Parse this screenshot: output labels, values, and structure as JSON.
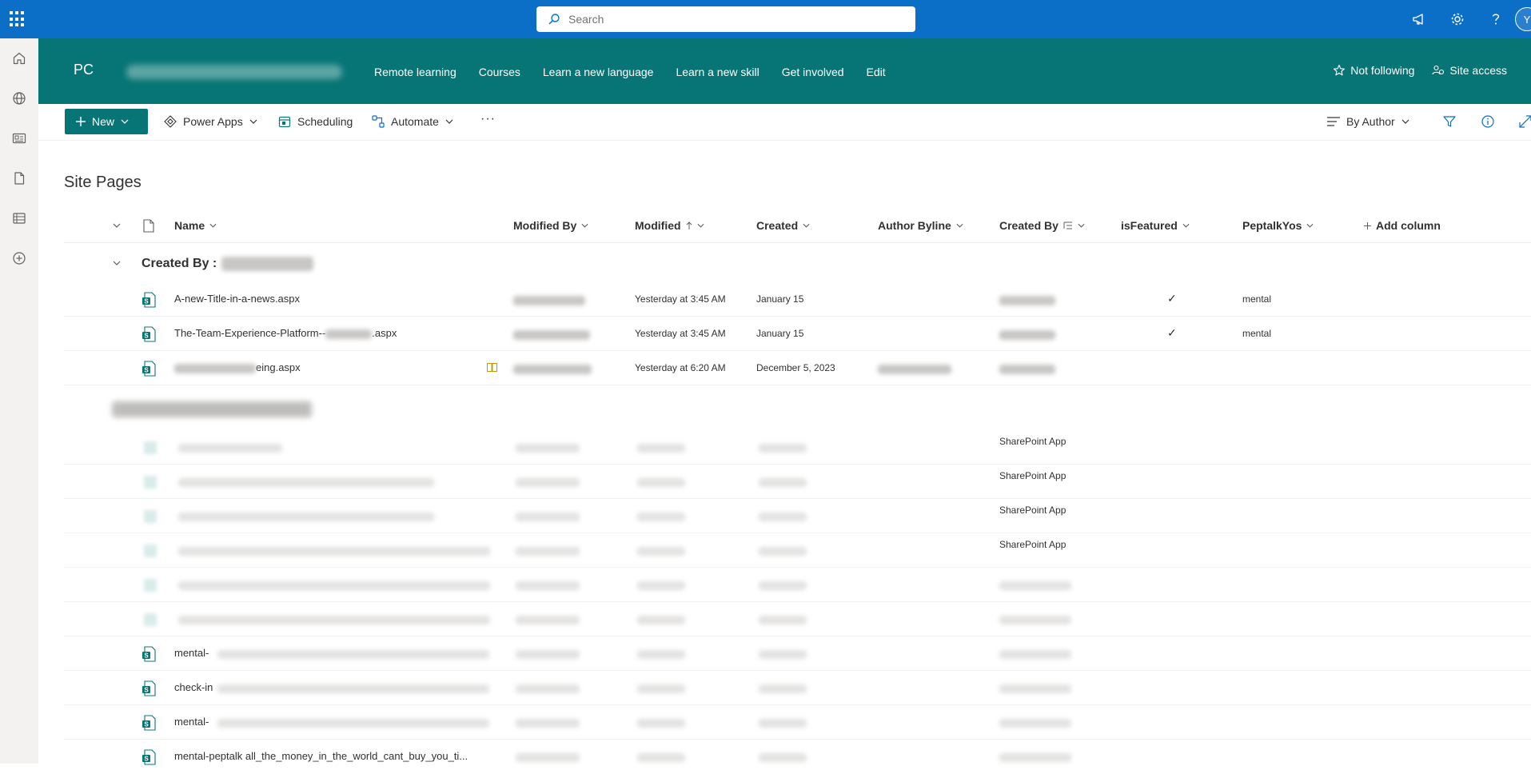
{
  "suite": {
    "search_placeholder": "Search",
    "avatar_initial": "Y"
  },
  "site": {
    "logo": "PC",
    "nav": [
      "Remote learning",
      "Courses",
      "Learn a new language",
      "Learn a new skill",
      "Get involved",
      "Edit"
    ],
    "not_following": "Not following",
    "site_access": "Site access"
  },
  "commands": {
    "new": "New",
    "power_apps": "Power Apps",
    "scheduling": "Scheduling",
    "automate": "Automate",
    "more": "···",
    "view": "By Author"
  },
  "list": {
    "title": "Site Pages",
    "columns": {
      "name": "Name",
      "modified_by": "Modified By",
      "modified": "Modified",
      "created": "Created",
      "author_byline": "Author Byline",
      "created_by": "Created By",
      "is_featured": "isFeatured",
      "peptalk": "PeptalkYos",
      "add_column": "Add column"
    },
    "group1_label": "Created By :",
    "rows": [
      {
        "name": "A-new-Title-in-a-news.aspx",
        "modified": "Yesterday at 3:45 AM",
        "created": "January 15",
        "featured": "✓",
        "peptalk": "mental"
      },
      {
        "name": "The-Team-Experience-Platform--",
        "name_suffix": ".aspx",
        "modified": "Yesterday at 3:45 AM",
        "created": "January 15",
        "featured": "✓",
        "peptalk": "mental"
      },
      {
        "name_suffix": "eing.aspx",
        "modified": "Yesterday at 6:20 AM",
        "created": "December 5, 2023",
        "featured": "",
        "peptalk": ""
      }
    ],
    "group2_rows": [
      {
        "created_by": "SharePoint App"
      },
      {
        "created_by": "SharePoint App"
      },
      {
        "created_by": "SharePoint App"
      },
      {
        "created_by": "SharePoint App"
      }
    ],
    "tail_rows": [
      {
        "name": "mental-"
      },
      {
        "name": "check-in"
      },
      {
        "name": "mental-"
      },
      {
        "name": "mental-peptalk all_the_money_in_the_world_cant_buy_you_ti..."
      }
    ]
  }
}
